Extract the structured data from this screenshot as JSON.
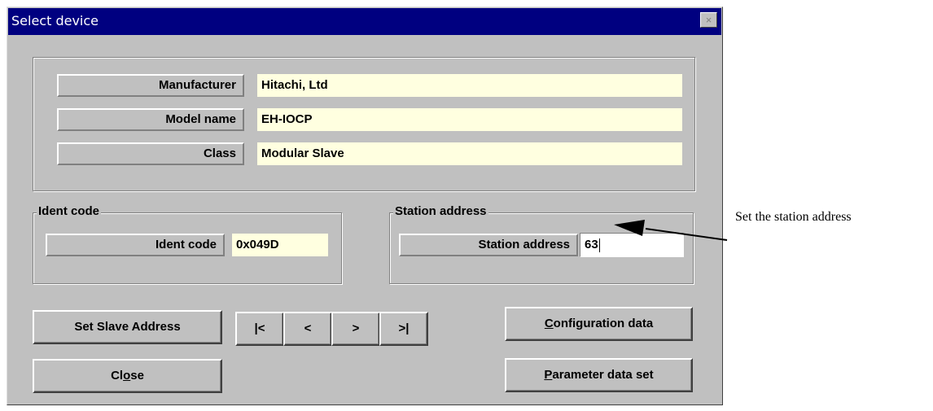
{
  "window": {
    "title": "Select device",
    "close_icon": "×"
  },
  "device": {
    "manufacturer_label": "Manufacturer",
    "manufacturer_value": "Hitachi, Ltd",
    "model_label": "Model name",
    "model_value": "EH-IOCP",
    "class_label": "Class",
    "class_value": "Modular Slave"
  },
  "ident": {
    "group_title": "Ident code",
    "label": "Ident code",
    "value": "0x049D"
  },
  "station": {
    "group_title": "Station address",
    "label": "Station address",
    "value": "63"
  },
  "buttons": {
    "set_slave": "Set Slave Address",
    "close": "Close",
    "close_mnemonic_index": 2,
    "first": "|<",
    "prev": "<",
    "next": ">",
    "last": ">|",
    "config": "Configuration data",
    "config_mnemonic_index": 0,
    "param": "Parameter data set",
    "param_mnemonic_index": 0
  },
  "annotation": {
    "text": "Set the station address"
  },
  "colors": {
    "title_bar": "#000080",
    "value_field_bg": "#ffffe0",
    "dialog_bg": "#c0c0c0"
  }
}
